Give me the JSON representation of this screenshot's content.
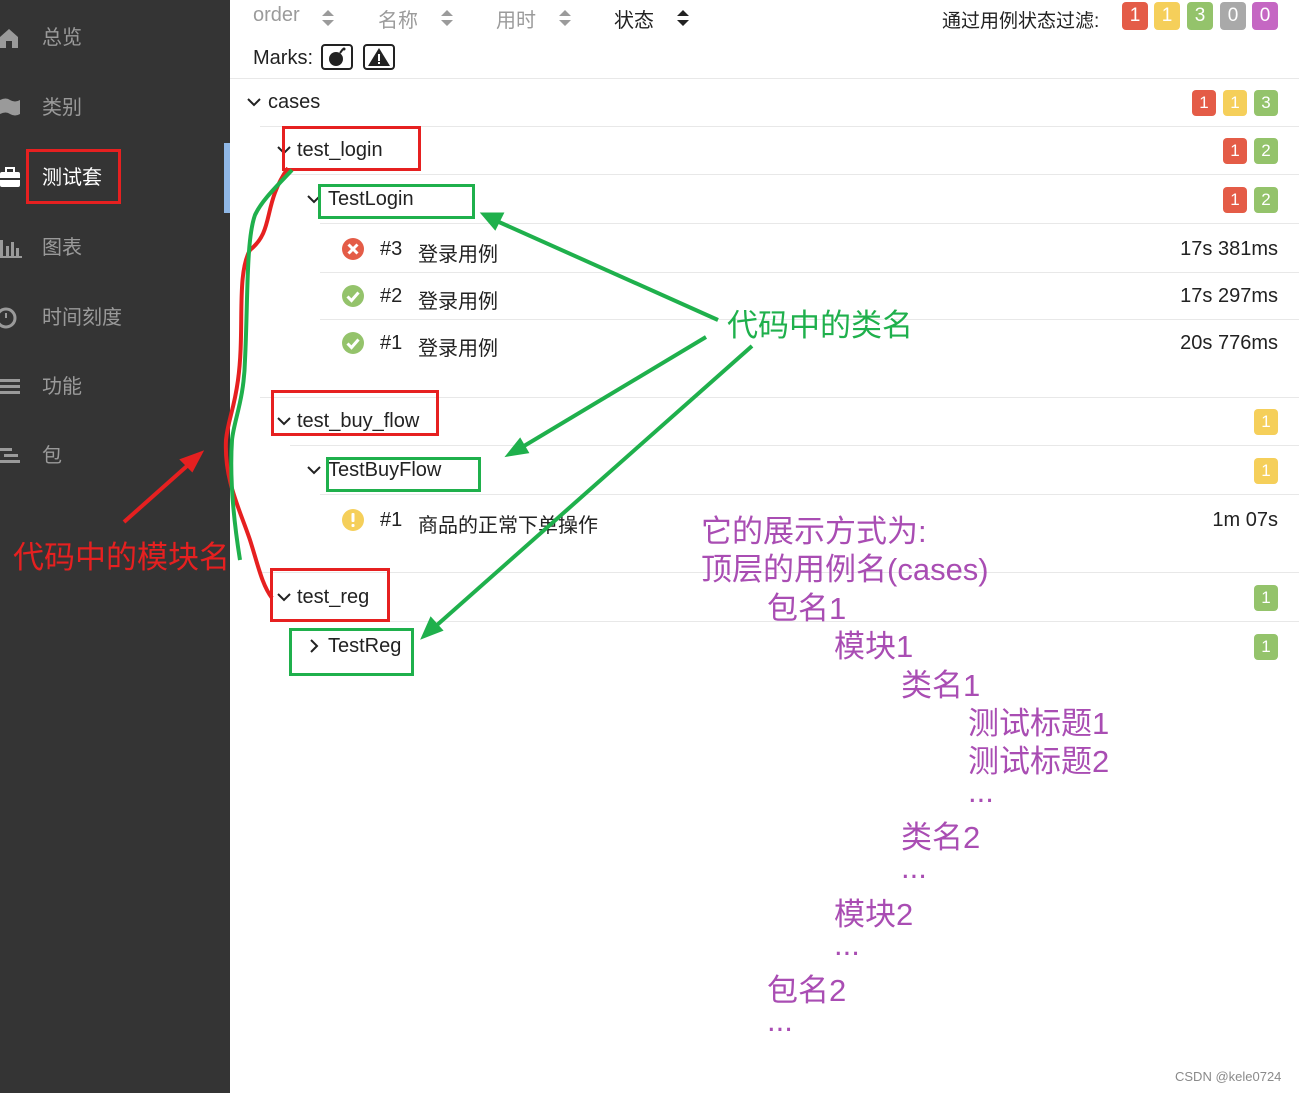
{
  "sidebar": {
    "items": [
      {
        "label": "总览",
        "icon": "home-icon"
      },
      {
        "label": "类别",
        "icon": "flag-icon"
      },
      {
        "label": "测试套",
        "icon": "briefcase-icon",
        "active": true
      },
      {
        "label": "图表",
        "icon": "bar-chart-icon"
      },
      {
        "label": "时间刻度",
        "icon": "clock-icon"
      },
      {
        "label": "功能",
        "icon": "list-icon"
      },
      {
        "label": "包",
        "icon": "tree-list-icon"
      }
    ]
  },
  "header": {
    "sort": [
      "order",
      "名称",
      "用时",
      "状态"
    ],
    "filter_label": "通过用例状态过滤:",
    "filter_badges": [
      {
        "value": "1",
        "color": "#e45c47"
      },
      {
        "value": "1",
        "color": "#f5cf5a"
      },
      {
        "value": "3",
        "color": "#94c36b"
      },
      {
        "value": "0",
        "color": "#a9a9a9"
      },
      {
        "value": "0",
        "color": "#c567c3"
      }
    ],
    "marks_label": "Marks:"
  },
  "tree": {
    "root": {
      "name": "cases",
      "badges": [
        "1",
        "1",
        "3"
      ]
    },
    "modules": [
      {
        "name": "test_login",
        "badges": [
          "1",
          "2"
        ],
        "class": {
          "name": "TestLogin",
          "badges": [
            "1",
            "2"
          ]
        },
        "cases": [
          {
            "status": "failed",
            "num": "#3",
            "title": "登录用例",
            "duration": "17s 381ms"
          },
          {
            "status": "passed",
            "num": "#2",
            "title": "登录用例",
            "duration": "17s 297ms"
          },
          {
            "status": "passed",
            "num": "#1",
            "title": "登录用例",
            "duration": "20s 776ms"
          }
        ]
      },
      {
        "name": "test_buy_flow",
        "badges": [
          "1"
        ],
        "class": {
          "name": "TestBuyFlow",
          "badges": [
            "1"
          ]
        },
        "cases": [
          {
            "status": "broken",
            "num": "#1",
            "title": "商品的正常下单操作",
            "duration": "1m 07s"
          }
        ]
      },
      {
        "name": "test_reg",
        "badges": [
          "1"
        ],
        "class": {
          "name": "TestReg",
          "badges": [
            "1"
          ]
        }
      }
    ]
  },
  "annotations": {
    "class_name_label": "代码中的类名",
    "module_name_label": "代码中的模块名",
    "explanation": [
      "它的展示方式为:",
      "顶层的用例名(cases)",
      "包名1",
      "模块1",
      "类名1",
      "测试标题1",
      "测试标题2",
      "...",
      "类名2",
      "...",
      "模块2",
      "...",
      "包名2",
      "..."
    ]
  },
  "watermark": "CSDN @kele0724"
}
